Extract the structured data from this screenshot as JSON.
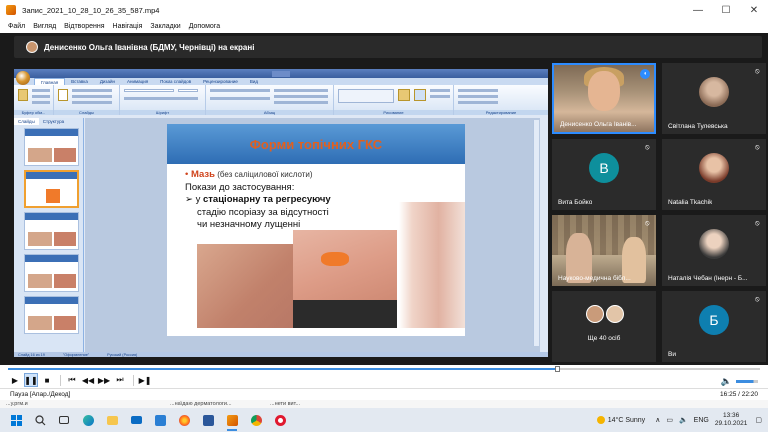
{
  "window": {
    "title": "Запис_2021_10_28_10_26_35_587.mp4",
    "controls": [
      "—",
      "☐",
      "✕"
    ]
  },
  "menu": [
    "Файл",
    "Вигляд",
    "Відтворення",
    "Навігація",
    "Закладки",
    "Допомога"
  ],
  "zoom": {
    "share_banner": "Денисенко Ольга Іванівна (БДМУ, Чернівці) на екрані",
    "participants": [
      {
        "name": "Денисенко Ольга Іванів...",
        "type": "video",
        "mic": "on"
      },
      {
        "name": "Світлана Тулевська",
        "type": "photo",
        "mic": "muted"
      },
      {
        "name": "Вита Бойко",
        "type": "initial",
        "initial": "В",
        "color": "#0e8f9c",
        "mic": "muted"
      },
      {
        "name": "Natalia Tkachik",
        "type": "photo",
        "mic": "muted"
      },
      {
        "name": "Науково-медична бібл...",
        "type": "video",
        "mic": "muted"
      },
      {
        "name": "Наталія Чебан (Інерн - Б...",
        "type": "photo",
        "mic": "muted"
      },
      {
        "name": "Ще 40 осіб",
        "type": "more"
      },
      {
        "name": "Ви",
        "type": "initial",
        "initial": "Б",
        "color": "#0e7fb0",
        "mic": "muted"
      }
    ]
  },
  "ppt": {
    "tabs": [
      "Главная",
      "Вставка",
      "Дизайн",
      "Анимация",
      "Показ слайдов",
      "Рецензирование",
      "Вид"
    ],
    "groups": [
      "Буфер обм...",
      "Слайды",
      "Шрифт",
      "Абзац",
      "Рисование",
      "Редактирование"
    ],
    "panel_tabs": [
      "Слайды",
      "Структура"
    ],
    "slide": {
      "title": "Форми топічних ГКС",
      "bullet_red": "Мазь",
      "bullet_gray": " (без саліцилової кислоти)",
      "line2": "Покази до застосування:",
      "line3_prefix": "➢ у ",
      "line3_bold": "стаціонарну та регресуючу",
      "line4": "стадію псоріазу за відсутності",
      "line5": "чи незначному лущенні"
    },
    "status": [
      "Слайд 16 из 19",
      "\"Оформление\"",
      "Русский (Россия)"
    ]
  },
  "player": {
    "status_left": "Пауза [Апар./Декод]",
    "time": "16:25 / 22:20",
    "progress": 0.73
  },
  "behind_text": [
    "...у.ргм.и",
    "...на\\даю дерматологи...",
    "...нети вит..."
  ],
  "tray": {
    "weather": "14°C  Sunny",
    "lang": "ENG",
    "time": "13:36",
    "date": "29.10.2021"
  }
}
